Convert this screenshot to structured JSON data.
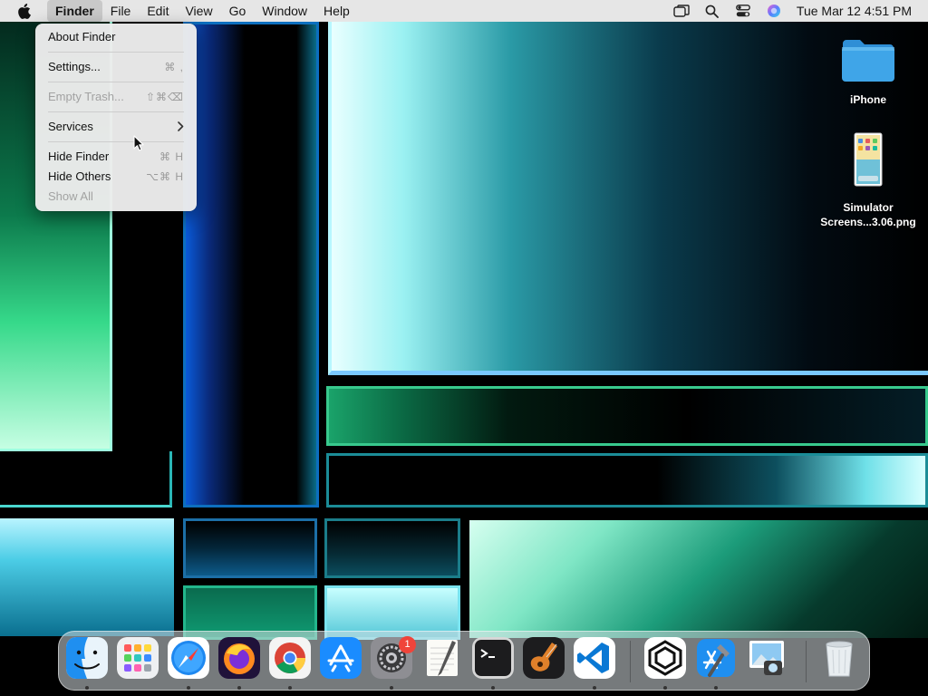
{
  "menubar": {
    "app_name": "Finder",
    "items": [
      "File",
      "Edit",
      "View",
      "Go",
      "Window",
      "Help"
    ],
    "clock": "Tue Mar 12  4:51 PM",
    "status_icons": [
      "window-overlap-icon",
      "search-icon",
      "control-center-icon",
      "siri-icon"
    ]
  },
  "finder_menu": {
    "items": [
      {
        "label": "About Finder",
        "shortcut": "",
        "enabled": true
      },
      {
        "label": "Settings...",
        "shortcut": "⌘ ,",
        "enabled": true
      },
      {
        "label": "Empty Trash...",
        "shortcut": "⇧⌘⌫",
        "enabled": false
      },
      {
        "label": "Services",
        "shortcut": "",
        "enabled": true,
        "submenu": true
      },
      {
        "label": "Hide Finder",
        "shortcut": "⌘ H",
        "enabled": true
      },
      {
        "label": "Hide Others",
        "shortcut": "⌥⌘ H",
        "enabled": true
      },
      {
        "label": "Show All",
        "shortcut": "",
        "enabled": false
      }
    ]
  },
  "desktop": {
    "icons": [
      {
        "label": "iPhone",
        "icon": "folder-icon"
      },
      {
        "label_line1": "Simulator",
        "label_line2": "Screens...3.06.png",
        "icon": "screenshot-file-icon"
      }
    ]
  },
  "dock": {
    "apps": [
      "finder",
      "launchpad",
      "safari",
      "firefox",
      "chrome",
      "app-store",
      "system-settings",
      "textedit",
      "terminal",
      "garageband",
      "vscode",
      "unity",
      "xcode",
      "preview",
      "trash"
    ],
    "system_settings_badge": "1"
  },
  "colors": {
    "menubar_bg": "#e6e6e6",
    "folder_blue": "#3fa5e8",
    "badge_red": "#f0443a"
  }
}
